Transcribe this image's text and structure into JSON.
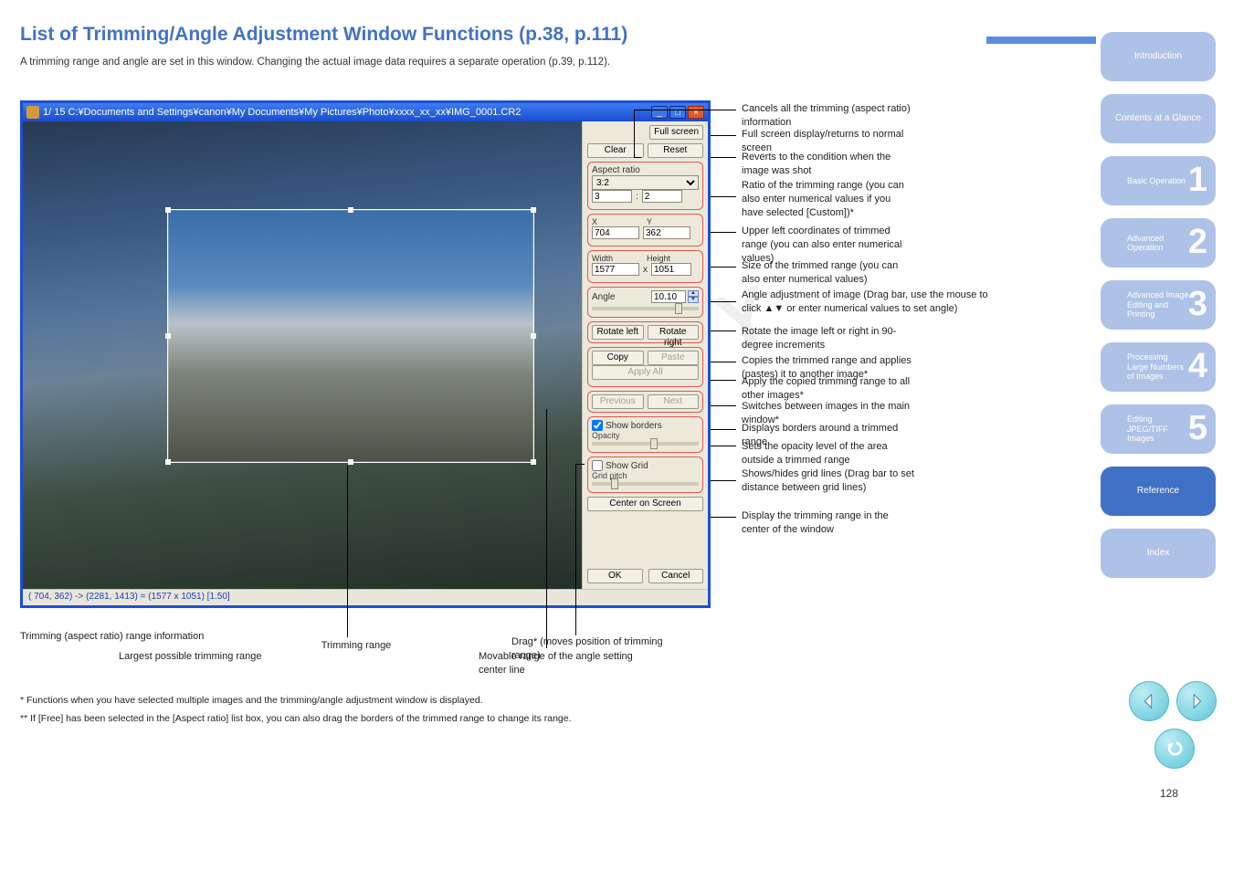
{
  "page": {
    "number": "128"
  },
  "heading": "List of Trimming/Angle Adjustment Window Functions (p.38, p.111)",
  "intro": "A trimming range and angle are set in this window. Changing the actual image data requires a separate operation (p.39, p.112).",
  "nav": {
    "intro": "Introduction",
    "contents": "Contents at a Glance",
    "t1": "Basic Operation",
    "t2": "Advanced Operation",
    "t3": "Advanced Image Editing and Printing",
    "t4": "Processing Large Numbers of Images",
    "t5": "Editing JPEG/TIFF Images",
    "ref": "Reference",
    "index": "Index"
  },
  "window": {
    "title": "1/ 15  C:¥Documents and Settings¥canon¥My Documents¥My Pictures¥Photo¥xxxx_xx_xx¥IMG_0001.CR2",
    "status": "( 704, 362) -> (2281, 1413) = (1577 x 1051) [1.50]"
  },
  "panel": {
    "fullscreen": "Full screen",
    "clear": "Clear",
    "reset": "Reset",
    "aspect_label": "Aspect ratio",
    "aspect_sel": "3:2",
    "aspect_w": "3",
    "aspect_h": "2",
    "x_lbl": "X",
    "y_lbl": "Y",
    "x": "704",
    "y": "362",
    "w_lbl": "Width",
    "h_lbl": "Height",
    "w": "1577",
    "h": "1051",
    "angle_lbl": "Angle",
    "angle": "10.10",
    "rotate_left": "Rotate left",
    "rotate_right": "Rotate right",
    "copy": "Copy",
    "paste": "Paste",
    "apply_all": "Apply All",
    "previous": "Previous",
    "next": "Next",
    "show_borders": "Show borders",
    "opacity": "Opacity",
    "show_grid": "Show Grid",
    "grid_pitch": "Grid pitch",
    "center": "Center on Screen",
    "ok": "OK",
    "cancel": "Cancel"
  },
  "callouts": {
    "fullscreen": "Full screen display/returns to normal screen",
    "reset": "Reverts to the condition when the image was shot",
    "clear": "Cancels all the trimming (aspect ratio) information",
    "ratio": "Ratio of the trimming range (you can also enter numerical values if you have selected [Custom])*",
    "xy": "Upper left coordinates of trimmed range (you can also enter numerical values)",
    "wh": "Size of the trimmed range (you can also enter numerical values)",
    "angle": "Angle adjustment of image (Drag bar, use the mouse to click ▲▼ or enter numerical values to set angle)",
    "rotate": "Rotate the image left or right in 90-degree increments",
    "copy": "Copies the trimmed range and applies (pastes) it to another image*",
    "apply": "Apply the copied trimming range to all other images*",
    "prevnext": "Switches between images in the main window*",
    "opacity": "Sets the opacity level of the area outside a trimmed range",
    "border": "Displays borders around a trimmed range",
    "grid": "Shows/hides grid lines (Drag bar to set distance between grid lines)",
    "center": "Display the trimming range in the center of the window",
    "range": "Trimming range",
    "move": "Movable range of the angle setting center line",
    "drag": "Drag* (moves position of trimming range)",
    "info": "Trimming (aspect ratio) range information",
    "largest": "Largest possible trimming range",
    "star": "* Functions when you have selected multiple images and the trimming/angle adjustment window is displayed.",
    "aspect_note": "** If [Free] has been selected in the [Aspect ratio] list box, you can also drag the borders of the trimmed range to change its range."
  }
}
